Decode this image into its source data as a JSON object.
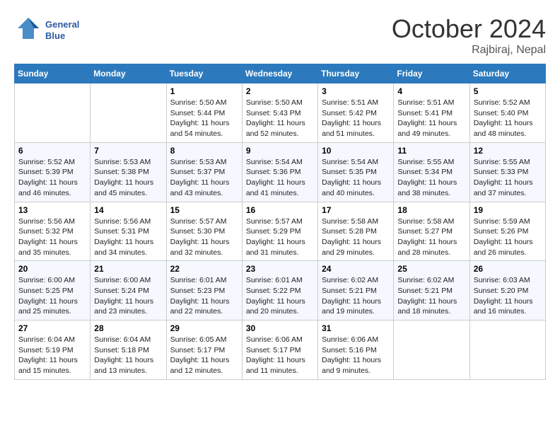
{
  "header": {
    "logo_line1": "General",
    "logo_line2": "Blue",
    "month_title": "October 2024",
    "location": "Rajbiraj, Nepal"
  },
  "weekdays": [
    "Sunday",
    "Monday",
    "Tuesday",
    "Wednesday",
    "Thursday",
    "Friday",
    "Saturday"
  ],
  "weeks": [
    [
      {
        "day": "",
        "info": ""
      },
      {
        "day": "",
        "info": ""
      },
      {
        "day": "1",
        "info": "Sunrise: 5:50 AM\nSunset: 5:44 PM\nDaylight: 11 hours and 54 minutes."
      },
      {
        "day": "2",
        "info": "Sunrise: 5:50 AM\nSunset: 5:43 PM\nDaylight: 11 hours and 52 minutes."
      },
      {
        "day": "3",
        "info": "Sunrise: 5:51 AM\nSunset: 5:42 PM\nDaylight: 11 hours and 51 minutes."
      },
      {
        "day": "4",
        "info": "Sunrise: 5:51 AM\nSunset: 5:41 PM\nDaylight: 11 hours and 49 minutes."
      },
      {
        "day": "5",
        "info": "Sunrise: 5:52 AM\nSunset: 5:40 PM\nDaylight: 11 hours and 48 minutes."
      }
    ],
    [
      {
        "day": "6",
        "info": "Sunrise: 5:52 AM\nSunset: 5:39 PM\nDaylight: 11 hours and 46 minutes."
      },
      {
        "day": "7",
        "info": "Sunrise: 5:53 AM\nSunset: 5:38 PM\nDaylight: 11 hours and 45 minutes."
      },
      {
        "day": "8",
        "info": "Sunrise: 5:53 AM\nSunset: 5:37 PM\nDaylight: 11 hours and 43 minutes."
      },
      {
        "day": "9",
        "info": "Sunrise: 5:54 AM\nSunset: 5:36 PM\nDaylight: 11 hours and 41 minutes."
      },
      {
        "day": "10",
        "info": "Sunrise: 5:54 AM\nSunset: 5:35 PM\nDaylight: 11 hours and 40 minutes."
      },
      {
        "day": "11",
        "info": "Sunrise: 5:55 AM\nSunset: 5:34 PM\nDaylight: 11 hours and 38 minutes."
      },
      {
        "day": "12",
        "info": "Sunrise: 5:55 AM\nSunset: 5:33 PM\nDaylight: 11 hours and 37 minutes."
      }
    ],
    [
      {
        "day": "13",
        "info": "Sunrise: 5:56 AM\nSunset: 5:32 PM\nDaylight: 11 hours and 35 minutes."
      },
      {
        "day": "14",
        "info": "Sunrise: 5:56 AM\nSunset: 5:31 PM\nDaylight: 11 hours and 34 minutes."
      },
      {
        "day": "15",
        "info": "Sunrise: 5:57 AM\nSunset: 5:30 PM\nDaylight: 11 hours and 32 minutes."
      },
      {
        "day": "16",
        "info": "Sunrise: 5:57 AM\nSunset: 5:29 PM\nDaylight: 11 hours and 31 minutes."
      },
      {
        "day": "17",
        "info": "Sunrise: 5:58 AM\nSunset: 5:28 PM\nDaylight: 11 hours and 29 minutes."
      },
      {
        "day": "18",
        "info": "Sunrise: 5:58 AM\nSunset: 5:27 PM\nDaylight: 11 hours and 28 minutes."
      },
      {
        "day": "19",
        "info": "Sunrise: 5:59 AM\nSunset: 5:26 PM\nDaylight: 11 hours and 26 minutes."
      }
    ],
    [
      {
        "day": "20",
        "info": "Sunrise: 6:00 AM\nSunset: 5:25 PM\nDaylight: 11 hours and 25 minutes."
      },
      {
        "day": "21",
        "info": "Sunrise: 6:00 AM\nSunset: 5:24 PM\nDaylight: 11 hours and 23 minutes."
      },
      {
        "day": "22",
        "info": "Sunrise: 6:01 AM\nSunset: 5:23 PM\nDaylight: 11 hours and 22 minutes."
      },
      {
        "day": "23",
        "info": "Sunrise: 6:01 AM\nSunset: 5:22 PM\nDaylight: 11 hours and 20 minutes."
      },
      {
        "day": "24",
        "info": "Sunrise: 6:02 AM\nSunset: 5:21 PM\nDaylight: 11 hours and 19 minutes."
      },
      {
        "day": "25",
        "info": "Sunrise: 6:02 AM\nSunset: 5:21 PM\nDaylight: 11 hours and 18 minutes."
      },
      {
        "day": "26",
        "info": "Sunrise: 6:03 AM\nSunset: 5:20 PM\nDaylight: 11 hours and 16 minutes."
      }
    ],
    [
      {
        "day": "27",
        "info": "Sunrise: 6:04 AM\nSunset: 5:19 PM\nDaylight: 11 hours and 15 minutes."
      },
      {
        "day": "28",
        "info": "Sunrise: 6:04 AM\nSunset: 5:18 PM\nDaylight: 11 hours and 13 minutes."
      },
      {
        "day": "29",
        "info": "Sunrise: 6:05 AM\nSunset: 5:17 PM\nDaylight: 11 hours and 12 minutes."
      },
      {
        "day": "30",
        "info": "Sunrise: 6:06 AM\nSunset: 5:17 PM\nDaylight: 11 hours and 11 minutes."
      },
      {
        "day": "31",
        "info": "Sunrise: 6:06 AM\nSunset: 5:16 PM\nDaylight: 11 hours and 9 minutes."
      },
      {
        "day": "",
        "info": ""
      },
      {
        "day": "",
        "info": ""
      }
    ]
  ]
}
